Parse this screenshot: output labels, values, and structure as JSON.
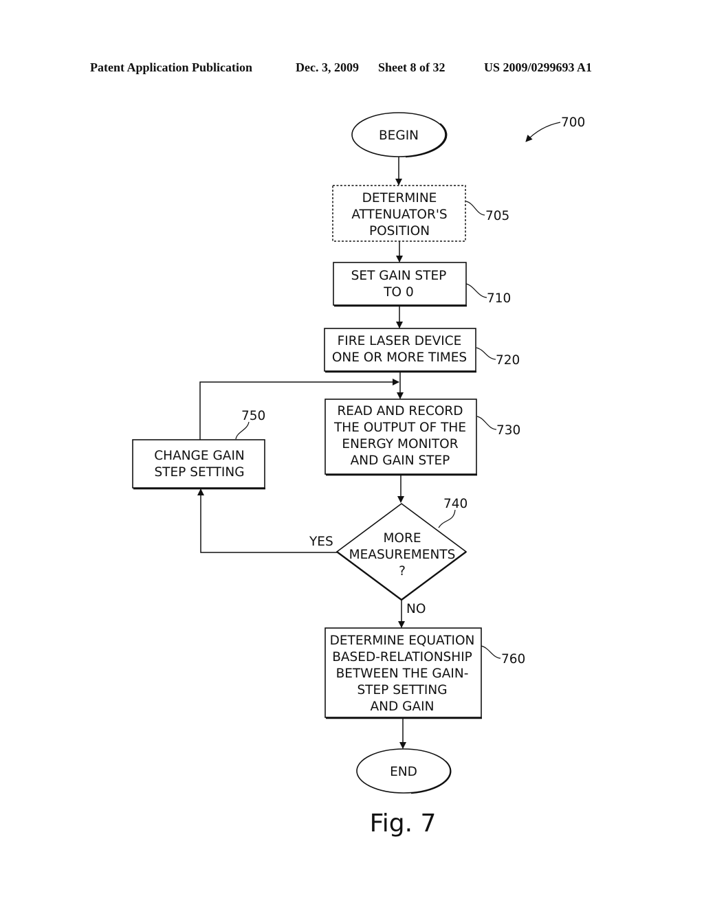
{
  "header": {
    "publication": "Patent Application Publication",
    "date": "Dec. 3, 2009",
    "sheet": "Sheet 8 of 32",
    "number": "US 2009/0299693 A1"
  },
  "figure": {
    "ref": "700",
    "caption": "Fig. 7"
  },
  "nodes": {
    "begin": {
      "lines": [
        "BEGIN"
      ]
    },
    "n705": {
      "ref": "705",
      "lines": [
        "DETERMINE",
        "ATTENUATOR'S",
        "POSITION"
      ],
      "style": "dashed"
    },
    "n710": {
      "ref": "710",
      "lines": [
        "SET GAIN STEP",
        "TO 0"
      ]
    },
    "n720": {
      "ref": "720",
      "lines": [
        "FIRE LASER DEVICE",
        "ONE OR MORE TIMES"
      ]
    },
    "n730": {
      "ref": "730",
      "lines": [
        "READ AND RECORD",
        "THE OUTPUT OF THE",
        "ENERGY MONITOR",
        "AND GAIN STEP"
      ]
    },
    "n740": {
      "ref": "740",
      "lines": [
        "MORE",
        "MEASUREMENTS",
        "?"
      ]
    },
    "n750": {
      "ref": "750",
      "lines": [
        "CHANGE GAIN",
        "STEP SETTING"
      ]
    },
    "n760": {
      "ref": "760",
      "lines": [
        "DETERMINE EQUATION",
        "BASED-RELATIONSHIP",
        "BETWEEN THE GAIN-",
        "STEP SETTING",
        "AND GAIN"
      ]
    },
    "end": {
      "lines": [
        "END"
      ]
    }
  },
  "edges": {
    "yes_label": "YES",
    "no_label": "NO"
  }
}
